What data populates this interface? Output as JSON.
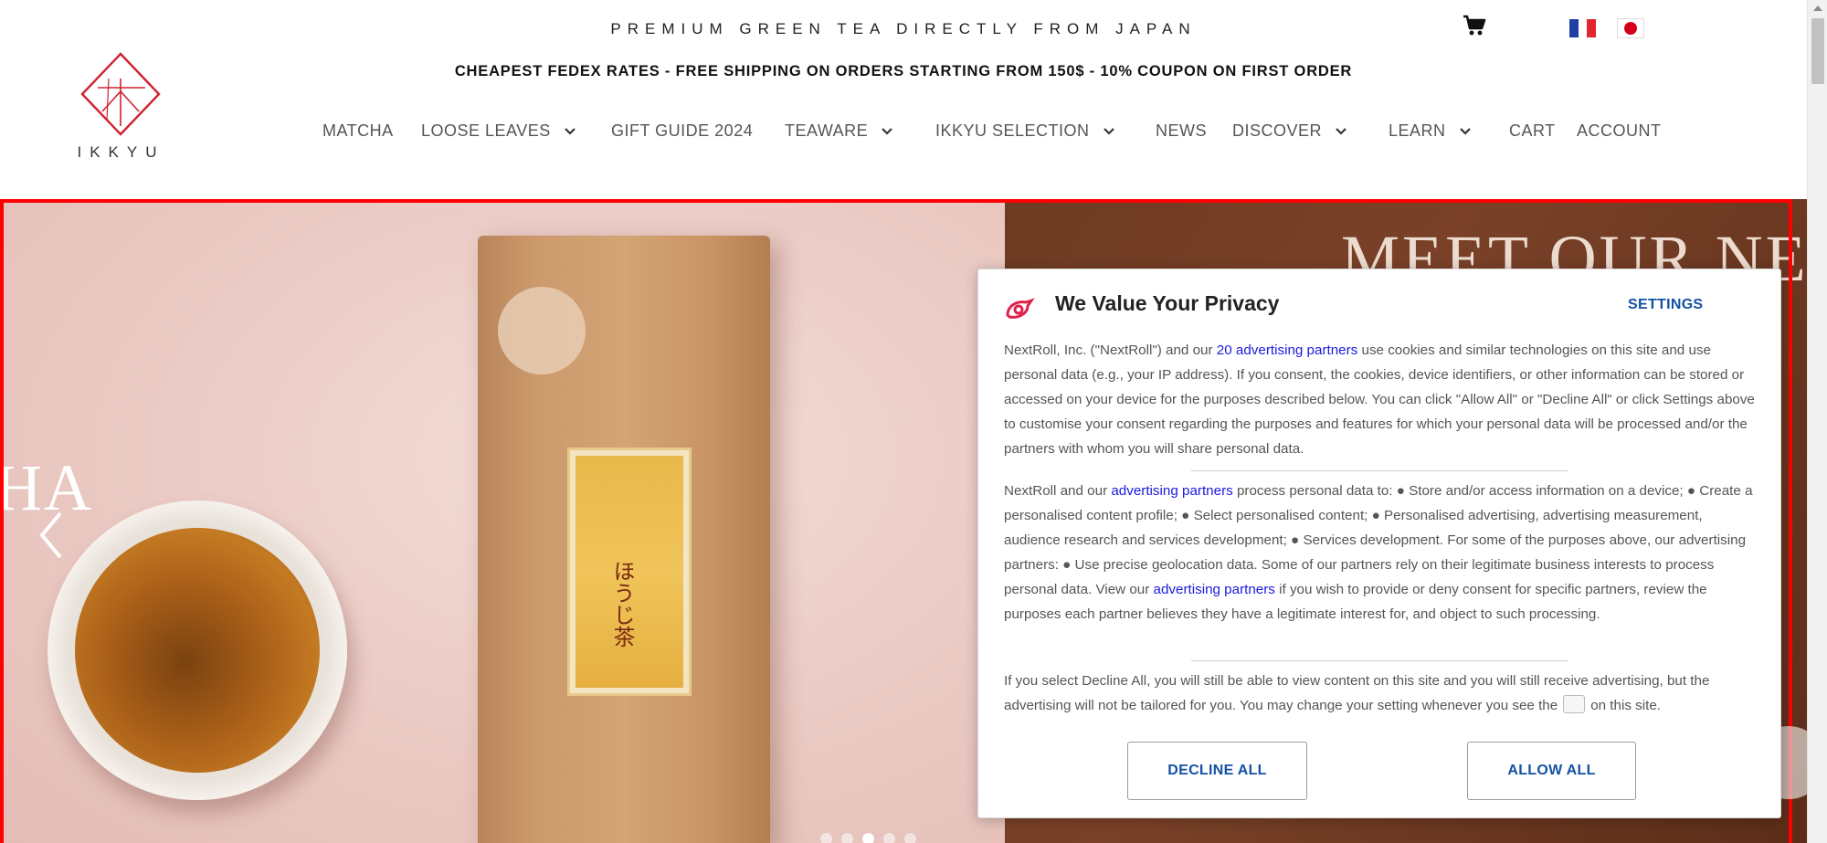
{
  "header": {
    "tagline": "PREMIUM GREEN TEA DIRECTLY FROM JAPAN",
    "shipping_banner": "CHEAPEST FEDEX RATES - FREE SHIPPING ON ORDERS STARTING FROM 150$ - 10% COUPON ON FIRST ORDER",
    "logo_text": "IKKYU",
    "cart_icon": "shopping-cart-icon",
    "languages": [
      "fr",
      "jp"
    ]
  },
  "nav": {
    "items": [
      {
        "label": "MATCHA",
        "dropdown": false
      },
      {
        "label": "LOOSE LEAVES",
        "dropdown": true
      },
      {
        "label": "GIFT GUIDE 2024",
        "dropdown": false
      },
      {
        "label": "TEAWARE",
        "dropdown": true
      },
      {
        "label": "IKKYU SELECTION",
        "dropdown": true
      },
      {
        "label": "NEWS",
        "dropdown": false
      },
      {
        "label": "DISCOVER",
        "dropdown": true
      },
      {
        "label": "LEARN",
        "dropdown": true
      },
      {
        "label": "CART",
        "dropdown": false
      },
      {
        "label": "ACCOUNT",
        "dropdown": false
      }
    ]
  },
  "hero": {
    "headline": "MEET OUR NE",
    "left_text": "HA",
    "bag_label_text": "ほうじ茶",
    "colors": {
      "left_bg": "#ebcac4",
      "right_bg": "#7a4128",
      "frame": "#ff0000"
    }
  },
  "privacy": {
    "title": "We Value Your Privacy",
    "settings_label": "SETTINGS",
    "p1_a": "NextRoll, Inc. (\"NextRoll\") and our ",
    "p1_link": "20 advertising partners",
    "p1_b": " use cookies and similar technologies on this site and use personal data (e.g., your IP address). If you consent, the cookies, device identifiers, or other information can be stored or accessed on your device for the purposes described below. You can click \"Allow All\" or \"Decline All\" or click Settings above to customise your consent regarding the purposes and features for which your personal data will be processed and/or the partners with whom you will share personal data.",
    "p2_a": "NextRoll and our ",
    "p2_link1": "advertising partners",
    "p2_b": " process personal data to: ● Store and/or access information on a device; ● Create a personalised content profile; ● Select personalised content; ● Personalised advertising, advertising measurement, audience research and services development; ● Services development. For some of the purposes above, our advertising partners: ● Use precise geolocation data. Some of our partners rely on their legitimate business interests to process personal data. View our ",
    "p2_link2": "advertising partners",
    "p2_c": " if you wish to provide or deny consent for specific partners, review the purposes each partner believes they have a legitimate interest for, and object to such processing.",
    "p3_a": "If you select Decline All, you will still be able to view content on this site and you will still receive advertising, but the advertising will not be tailored for you. You may change your setting whenever you see the",
    "p3_b": "on this site.",
    "decline_label": "DECLINE ALL",
    "allow_label": "ALLOW ALL",
    "accent_color": "#1352a2",
    "link_color": "#1a1adf"
  }
}
